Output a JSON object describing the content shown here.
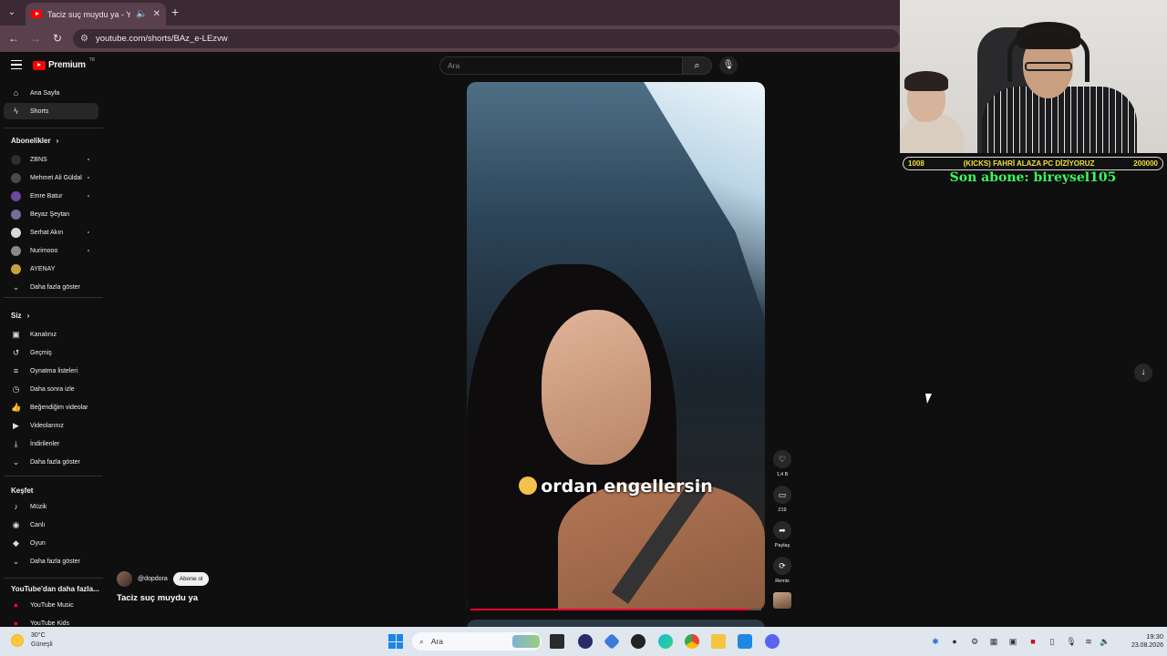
{
  "browser": {
    "tab_title": "Taciz suç muydu ya - YouTu",
    "url": "youtube.com/shorts/BAz_e-LEzvw"
  },
  "header": {
    "logo_text": "Premium",
    "country_code": "TR",
    "search_placeholder": "Ara"
  },
  "sidebar": {
    "main": [
      {
        "label": "Ana Sayfa",
        "icon": "home-icon"
      },
      {
        "label": "Shorts",
        "icon": "shorts-icon",
        "active": true
      }
    ],
    "subs_header": "Abonelikler",
    "subs": [
      {
        "label": "ZBNS",
        "color": "#2e2e2e",
        "dot": true
      },
      {
        "label": "Mehmet Ali Güldal",
        "color": "#4a4a4a",
        "dot": true
      },
      {
        "label": "Emre Batur",
        "color": "#6a4aa0",
        "dot": true
      },
      {
        "label": "Beyaz Şeytan",
        "color": "#7a6aa0",
        "dot": false
      },
      {
        "label": "Serhat Akın",
        "color": "#d8d8d8",
        "dot": true
      },
      {
        "label": "Nurimooo",
        "color": "#888888",
        "dot": true
      },
      {
        "label": "AYENAY",
        "color": "#c9a040",
        "dot": false
      }
    ],
    "subs_more": "Daha fazla göster",
    "you_header": "Siz",
    "you": [
      {
        "label": "Kanalınız",
        "icon": "channel-icon"
      },
      {
        "label": "Geçmiş",
        "icon": "history-icon"
      },
      {
        "label": "Oynatma listeleri",
        "icon": "playlist-icon"
      },
      {
        "label": "Daha sonra izle",
        "icon": "clock-icon"
      },
      {
        "label": "Beğendiğim videolar",
        "icon": "like-icon"
      },
      {
        "label": "Videolarınız",
        "icon": "video-icon"
      },
      {
        "label": "İndirilenler",
        "icon": "download-icon"
      },
      {
        "label": "Daha fazla göster",
        "icon": "chevron-down-icon"
      }
    ],
    "explore_header": "Keşfet",
    "explore": [
      {
        "label": "Müzik",
        "icon": "music-icon"
      },
      {
        "label": "Canlı",
        "icon": "live-icon"
      },
      {
        "label": "Oyun",
        "icon": "game-icon"
      },
      {
        "label": "Daha fazla göster",
        "icon": "chevron-down-icon"
      }
    ],
    "more_header": "YouTube'dan daha fazla...",
    "more": [
      {
        "label": "YouTube Music",
        "icon": "yt-music-icon"
      },
      {
        "label": "YouTube Kids",
        "icon": "yt-kids-icon"
      }
    ]
  },
  "short": {
    "caption": "ordan engellersin",
    "channel": "@dopdora",
    "subscribe_label": "Abone ol",
    "title": "Taciz suç muydu ya",
    "progress": 0.96,
    "actions": {
      "like_count": "1,4 B",
      "comment_count": "219",
      "share_label": "Paylaş",
      "remix_label": "Remix"
    }
  },
  "overlay": {
    "goal_left": "1008",
    "goal_title": "(KICKS) FAHRİ ALAZA PC DİZİYORUZ",
    "goal_right": "200000",
    "last_sub": "Son abone: bireysel105"
  },
  "taskbar": {
    "temperature": "30°C",
    "weather": "Güneşli",
    "search_label": "Ara",
    "time": "19:30",
    "date": "23.08.2026"
  },
  "colors": {
    "accent_red": "#ff0000",
    "goal_text": "#f0e040",
    "last_sub_text": "#38ff60"
  }
}
